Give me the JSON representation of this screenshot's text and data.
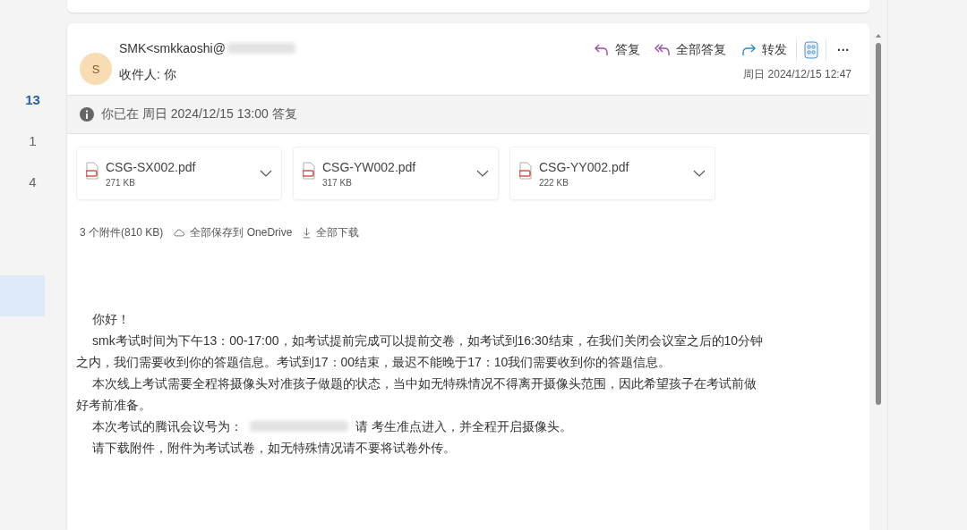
{
  "sidebar": {
    "counts": [
      {
        "label": "13",
        "unread": true
      },
      {
        "label": "1",
        "unread": false
      },
      {
        "label": "4",
        "unread": false
      }
    ]
  },
  "message": {
    "avatar": "S",
    "sender": "SMK<smkkaoshi@",
    "sender_redacted": true,
    "recipient": "收件人: 你",
    "date": "周日 2024/12/15 12:47",
    "actions": [
      {
        "kind": "reply",
        "label": "答复"
      },
      {
        "kind": "reply_all",
        "label": "全部答复"
      },
      {
        "kind": "forward",
        "label": "转发"
      },
      {
        "kind": "apps"
      },
      {
        "kind": "more",
        "label": "···"
      }
    ],
    "info": "你已在 周日 2024/12/15 13:00 答复",
    "attachments": [
      {
        "name": "CSG-SX002.pdf",
        "size": "271 KB"
      },
      {
        "name": "CSG-YW002.pdf",
        "size": "317 KB"
      },
      {
        "name": "CSG-YY002.pdf",
        "size": "222 KB"
      }
    ],
    "attachment_summary": "3 个附件(810 KB)",
    "save_all": "全部保存到 OneDrive",
    "download_all": "全部下载",
    "body": [
      {
        "kind": "text",
        "text": "你好！"
      },
      {
        "kind": "text",
        "text": "smk考试时间为下午13：00-17:00，如考试提前完成可以提前交卷，如考试到16:30结束，在我们关闭会议室之后的10分钟之内，我们需要收到你的答题信息。考试到17：00结束，最迟不能晚于17：10我们需要收到你的答题信息。"
      },
      {
        "kind": "text",
        "text": "本次线上考试需要全程将摄像头对准孩子做题的状态，当中如无特殊情况不得离开摄像头范围，因此希望孩子在考试前做好考前准备。"
      },
      {
        "kind": "redacted",
        "before": "本次考试的腾讯会议号为：",
        "after": "请 考生准点进入，并全程开启摄像头。"
      },
      {
        "kind": "text",
        "text": "请下载附件，附件为考试试卷，如无特殊情况请不要将试卷外传。"
      }
    ]
  }
}
